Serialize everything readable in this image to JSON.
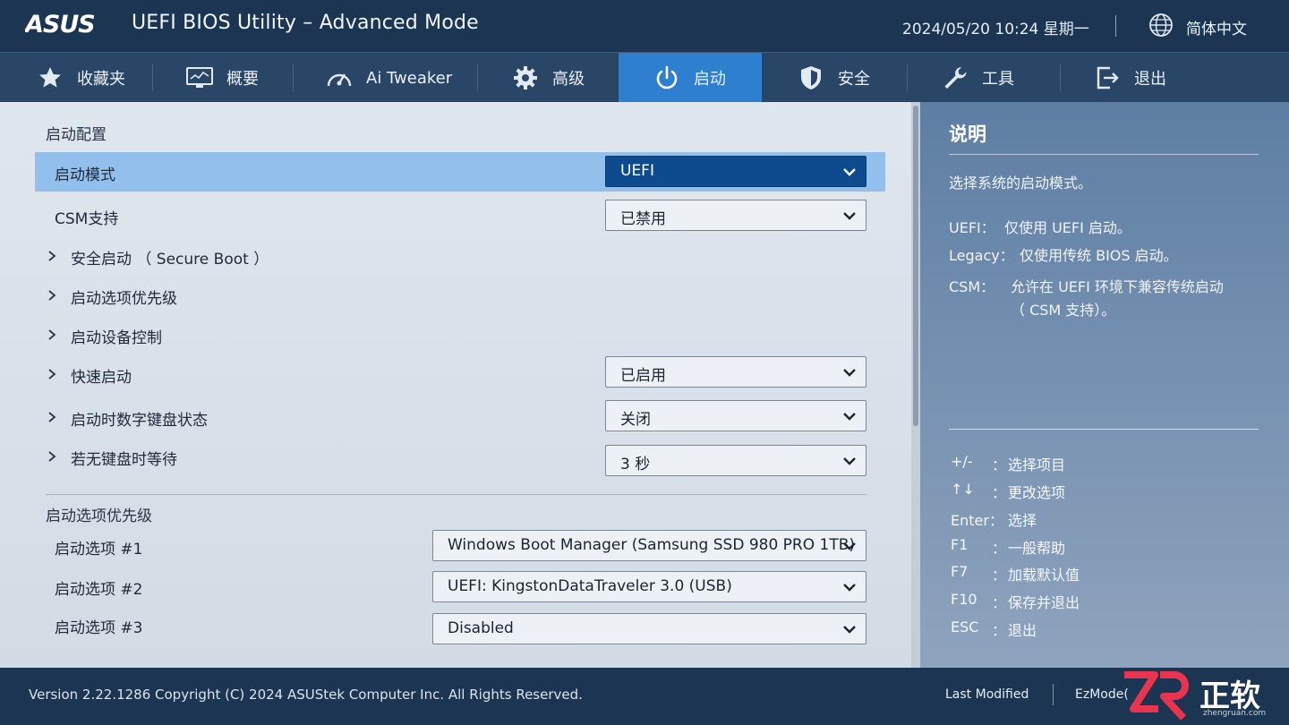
{
  "header": {
    "brand": "ASUS",
    "title": "UEFI BIOS Utility – Advanced Mode",
    "datetime": "2024/05/20  10:24  星期一",
    "language": "简体中文"
  },
  "tabs": [
    {
      "label": "收藏夹",
      "icon": "star-icon"
    },
    {
      "label": "概要",
      "icon": "monitor-icon"
    },
    {
      "label": "Ai Tweaker",
      "icon": "gauge-icon"
    },
    {
      "label": "高级",
      "icon": "gear-icon"
    },
    {
      "label": "启动",
      "icon": "power-icon",
      "active": true
    },
    {
      "label": "安全",
      "icon": "shield-icon"
    },
    {
      "label": "工具",
      "icon": "wrench-icon"
    },
    {
      "label": "退出",
      "icon": "exit-icon"
    }
  ],
  "main": {
    "section1": "启动配置",
    "boot_mode": {
      "label": "启动模式",
      "value": "UEFI"
    },
    "csm": {
      "label": "CSM支持",
      "value": "已禁用"
    },
    "secure_boot": {
      "label": "安全启动 （ Secure Boot ）"
    },
    "boot_priority_menu": {
      "label": "启动选项优先级"
    },
    "boot_device_control": {
      "label": "启动设备控制"
    },
    "fast_boot": {
      "label": "快速启动",
      "value": "已启用"
    },
    "numlock": {
      "label": "启动时数字键盘状态",
      "value": "关闭"
    },
    "no_keyboard_wait": {
      "label": "若无键盘时等待",
      "value": "3  秒"
    },
    "section2": "启动选项优先级",
    "boot_options": [
      {
        "label": "启动选项  #1",
        "value": "Windows  Boot Manager (Samsung SSD 980 PRO 1TB)"
      },
      {
        "label": "启动选项  #2",
        "value": "UEFI: KingstonDataTraveler 3.0 (USB)"
      },
      {
        "label": "启动选项  #3",
        "value": "Disabled"
      }
    ]
  },
  "description": {
    "title": "说明",
    "summary": "选择系统的启动模式。",
    "items": [
      {
        "key": "UEFI：",
        "value": "仅使用  UEFI 启动。"
      },
      {
        "key": "Legacy：",
        "value": "仅使用传统  BIOS 启动。"
      },
      {
        "key": "CSM：",
        "value": "允许在  UEFI 环境下兼容传统启动"
      }
    ],
    "csm_extra": "（ CSM 支持）。",
    "hotkeys": [
      {
        "key": "+/-",
        "colon": "：",
        "desc": "选择项目"
      },
      {
        "key": "↑↓",
        "colon": "：",
        "desc": "更改选项"
      },
      {
        "key": "Enter：",
        "colon": "",
        "desc": "选择"
      },
      {
        "key": "F1",
        "colon": "：",
        "desc": "一般帮助"
      },
      {
        "key": "F7",
        "colon": "：",
        "desc": "加载默认值"
      },
      {
        "key": "F10",
        "colon": "：",
        "desc": "保存并退出"
      },
      {
        "key": "ESC",
        "colon": "：",
        "desc": "退出"
      }
    ]
  },
  "footer": {
    "version": "Version 2.22.1286   Copyright (C) 2024   ASUStek Computer Inc.   All Rights Reserved.",
    "last_modified": "Last Modified",
    "ezmode": "EzMode(",
    "watermark": "正软",
    "watermark_sub": "zhengruan.com"
  },
  "colors": {
    "header_bg": "#1c3553",
    "tab_bg": "#2a4666",
    "tab_active": "#2f7fd0",
    "row_selected": "#93bfec",
    "dropdown_active": "#0e4b8e"
  }
}
